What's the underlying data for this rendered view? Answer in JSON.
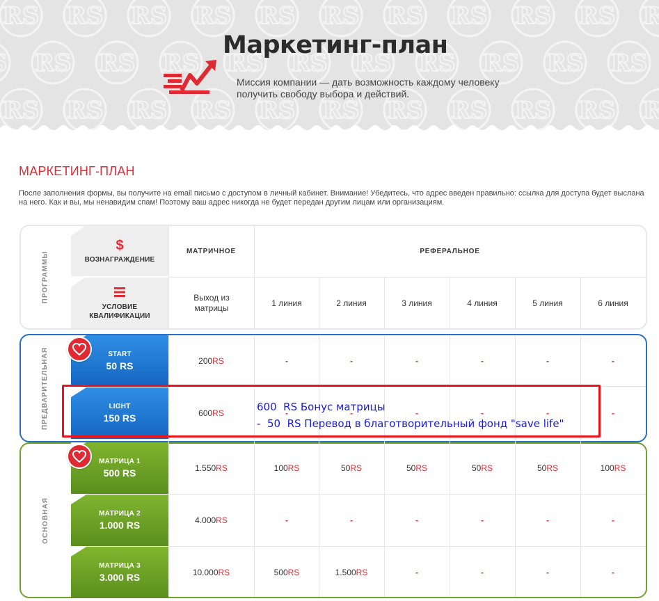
{
  "banner": {
    "title": "Маркетинг-план",
    "mission": "Миссия компании — дать возможность каждому человеку получить свободу выбора и действий.",
    "watermark": "RS",
    "accent": "#e02a33",
    "logo_icon": "growth-arrow-icon"
  },
  "section": {
    "title": "МАРКЕТИНГ-ПЛАН",
    "notice": "После заполнения формы, вы получите на email письмо с доступом в личный кабинет. Внимание! Убедитесь, что адрес введен правильно: ссылка для доступа будет выслана на него. Как и вы, мы ненавидим спам! Поэтому ваш адрес никогда не будет передан другим лицам или организациям."
  },
  "table": {
    "programs_label": "ПРОГРАММЫ",
    "reward_label": "ВОЗНАГРАЖДЕНИЕ",
    "reward_icon": "dollar-icon",
    "qualification_label": "УСЛОВИЕ КВАЛИФИКАЦИИ",
    "qualification_icon": "list-icon",
    "matrix_header": "МАТРИЧНОЕ",
    "referral_header": "РЕФЕРАЛЬНОЕ",
    "matrix_condition": "Выход из матрицы",
    "lines": [
      "1 линия",
      "2 линия",
      "3 линия",
      "4 линия",
      "5 линия",
      "6 линия"
    ],
    "currency": "RS",
    "preliminary": {
      "label": "ПРЕДВАРИТЕЛЬНАЯ",
      "border_color": "#2a6fc8",
      "rows": [
        {
          "name": "START",
          "price": "50 RS",
          "matrix": "200",
          "lines": [
            "-",
            "-",
            "-",
            "-",
            "-",
            "-"
          ]
        },
        {
          "name": "LIGHT",
          "price": "150 RS",
          "matrix": "600",
          "lines": [
            "-",
            "-",
            "-",
            "-",
            "-",
            "-"
          ]
        }
      ]
    },
    "main": {
      "label": "ОСНОВНАЯ",
      "border_color": "#6ea32c",
      "rows": [
        {
          "name": "МАТРИЦА 1",
          "price": "500 RS",
          "matrix": "1.550",
          "lines": [
            "100",
            "50",
            "50",
            "50",
            "50",
            "100"
          ]
        },
        {
          "name": "МАТРИЦА 2",
          "price": "1.000 RS",
          "matrix": "4.000",
          "lines": [
            "-",
            "-",
            "-",
            "-",
            "-",
            "-"
          ]
        },
        {
          "name": "МАТРИЦА 3",
          "price": "3.000 RS",
          "matrix": "10.000",
          "lines": [
            "500",
            "1.500",
            "-",
            "-",
            "-",
            "-"
          ]
        }
      ]
    },
    "favorite_icon": "heart-icon"
  },
  "annotation": {
    "line1": "600  RS Бонус матрицы",
    "line2": "-  50  RS Перевод в благотворительный фонд \"save life\"",
    "color": "#1a1ae0",
    "box_color": "#e8141b"
  }
}
